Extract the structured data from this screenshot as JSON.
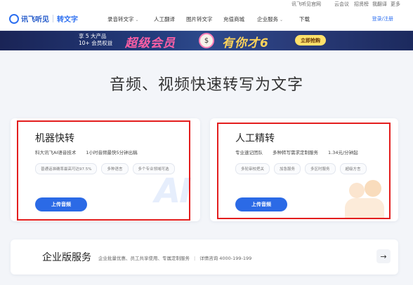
{
  "topbar": {
    "links": [
      "讯飞听见官网",
      "云会议",
      "招贤榜",
      "我翻译",
      "更多"
    ]
  },
  "nav": {
    "brand": "讯飞听见",
    "product": "转文字",
    "items": [
      {
        "label": "录音转文字",
        "has_dropdown": true
      },
      {
        "label": "人工翻译",
        "has_dropdown": false
      },
      {
        "label": "图片转文字",
        "has_dropdown": false
      },
      {
        "label": "充值商城",
        "has_dropdown": false
      },
      {
        "label": "企业服务",
        "has_dropdown": true
      },
      {
        "label": "下载",
        "has_dropdown": false
      }
    ],
    "login": "登录/注册"
  },
  "banner": {
    "line1": "享 5 大产品",
    "line2": "10+ 会员权益",
    "main_left": "超级会员",
    "cat_symbol": "$",
    "main_right": "有你才6",
    "button": "立即抢购",
    "colors": {
      "pink": "#ff5fa5",
      "gold": "#ffd45a",
      "bg": "#1f2f6a"
    }
  },
  "headline": "音频、视频快速转写为文字",
  "cards": [
    {
      "title": "机器快转",
      "desc": [
        "科大讯飞AI语音技术",
        "1小时音频最快5分钟出稿"
      ],
      "tags": [
        "普通话准确率最高可达97.5%",
        "多种语言",
        "多个专业领域可选"
      ],
      "button": "上传音频",
      "deco": "AI"
    },
    {
      "title": "人工精转",
      "desc": [
        "专业速记团队",
        "多种转写需求定制服务",
        "1.34元/分钟起"
      ],
      "tags": [
        "多轮审校把关",
        "加急服务",
        "多区时服务",
        "超级方言"
      ],
      "button": "上传音频"
    }
  ],
  "enterprise": {
    "title": "企业版服务",
    "desc": "企业批量优惠、员工共享使用、专属定制服务",
    "contact": "详情咨询 4000-199-199",
    "arrow": "→"
  },
  "accent": "#2b6ae6",
  "highlight": "#e31d1d"
}
